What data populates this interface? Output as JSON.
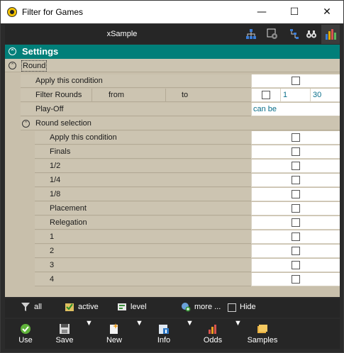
{
  "window": {
    "title": "Filter for Games",
    "minimize": "—",
    "maximize": "☐",
    "close": "✕"
  },
  "toolbar": {
    "sample_label": "xSample"
  },
  "settings": {
    "header": "Settings",
    "round_group": "Round",
    "apply_condition": "Apply this condition",
    "filter_rounds": {
      "label": "Filter Rounds",
      "from": "from",
      "to": "to",
      "from_value": "1",
      "to_value": "30"
    },
    "playoff": {
      "label": "Play-Off",
      "value": "can be"
    },
    "round_selection": "Round selection",
    "round_items": [
      "Apply this condition",
      "Finals",
      "1/2",
      "1/4",
      "1/8",
      "Placement",
      "Relegation",
      "1",
      "2",
      "3",
      "4"
    ]
  },
  "filterbar": {
    "all": "all",
    "active": "active",
    "level": "level",
    "more": "more ...",
    "hide": "Hide"
  },
  "bottombar": {
    "use": "Use",
    "save": "Save",
    "new": "New",
    "info": "Info",
    "odds": "Odds",
    "samples": "Samples"
  },
  "colors": {
    "header_teal": "#007f79",
    "grid_bg": "#c8bfab",
    "dark_bar": "#262626",
    "link": "#0a6f8a"
  },
  "icons": {
    "toolbar": [
      "tree-icon",
      "settings-gear-icon",
      "hierarchy-icon",
      "binoculars-icon",
      "bar-chart-icon"
    ],
    "filterbar": [
      "filter-all-icon",
      "checklist-icon",
      "level-icon",
      "more-plus-icon"
    ],
    "bottombar": [
      "use-check-icon",
      "save-disk-icon",
      "new-document-icon",
      "info-icon",
      "odds-chart-icon",
      "samples-folder-icon"
    ]
  }
}
